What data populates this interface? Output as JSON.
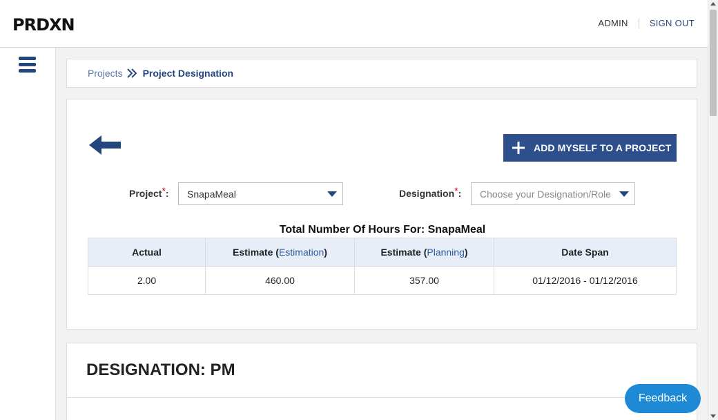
{
  "app": {
    "logo": "PRDXN"
  },
  "header": {
    "admin_label": "ADMIN",
    "signout_label": "SIGN OUT"
  },
  "sidebar": {
    "menu_icon": "hamburger-menu-icon"
  },
  "breadcrumb": {
    "parent": "Projects",
    "current": "Project Designation",
    "separator_icon": "double-chevron-right-icon"
  },
  "form": {
    "back_icon": "arrow-left-icon",
    "add_button_label": "ADD MYSELF TO A PROJECT",
    "add_button_icon": "plus-icon",
    "project_label": "Project",
    "project_value": "SnapaMeal",
    "designation_label": "Designation",
    "designation_placeholder": "Choose your Designation/Role",
    "required_mark": "*",
    "colon": ":"
  },
  "totals": {
    "title": "Total Number Of Hours For: SnapaMeal",
    "headers": {
      "actual": "Actual",
      "estimate_prefix": "Estimate (",
      "estimation_link": "Estimation",
      "planning_link": "Planning",
      "estimate_suffix": ")",
      "date_span": "Date Span"
    },
    "row": {
      "actual": "2.00",
      "estimation": "460.00",
      "planning": "357.00",
      "date_span": "01/12/2016 - 01/12/2016"
    }
  },
  "designation_section": {
    "title": "DESIGNATION: PM"
  },
  "feedback": {
    "label": "Feedback"
  },
  "colors": {
    "primary": "#2d4f8c",
    "nav_blue": "#24467e",
    "feedback_blue": "#1e8ad6",
    "table_header_bg": "#e8eef8",
    "required_red": "#d0021b"
  }
}
